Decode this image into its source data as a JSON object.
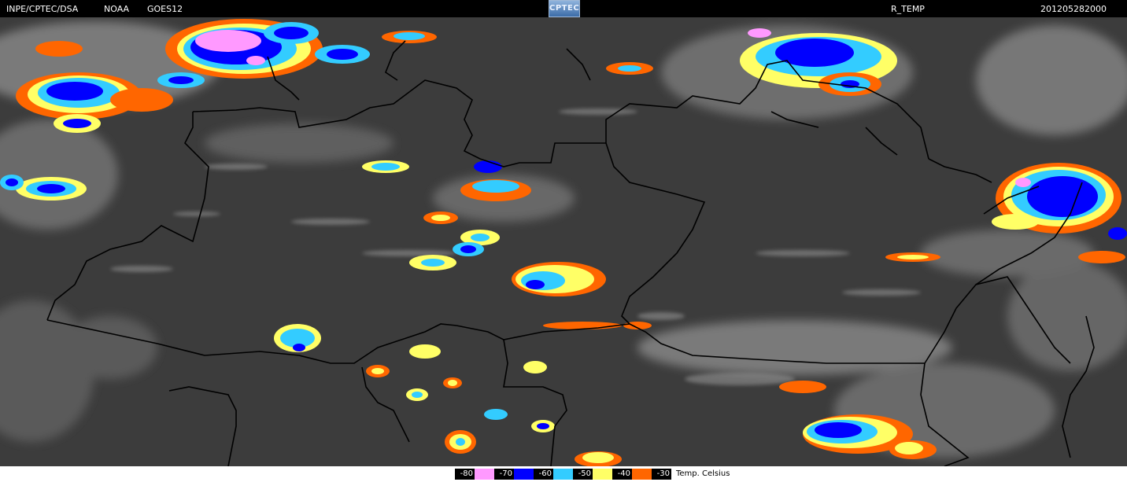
{
  "header": {
    "agency": "INPE/CPTEC/DSA",
    "provider": "NOAA",
    "satellite": "GOES12",
    "logo_text": "CPTEC",
    "product": "R_TEMP",
    "datetime": "201205282000"
  },
  "legend": {
    "unit": "Temp. Celsius",
    "items": [
      {
        "label": "-80",
        "color": "#000000"
      },
      {
        "label": "",
        "color": "#ff99ff"
      },
      {
        "label": "-70",
        "color": "#000000"
      },
      {
        "label": "",
        "color": "#0000ff"
      },
      {
        "label": "-60",
        "color": "#000000"
      },
      {
        "label": "",
        "color": "#33ccff"
      },
      {
        "label": "-50",
        "color": "#000000"
      },
      {
        "label": "",
        "color": "#ffff66"
      },
      {
        "label": "-40",
        "color": "#000000"
      },
      {
        "label": "",
        "color": "#ff6600"
      },
      {
        "label": "-30",
        "color": "#000000"
      }
    ]
  },
  "map": {
    "background_color": "#3c3c3c",
    "cloud_colors": {
      "minus80": "#ff99ff",
      "minus60": "#0000ff",
      "minus50": "#33ccff",
      "minus40": "#ffff66",
      "minus30": "#ff6600"
    }
  }
}
